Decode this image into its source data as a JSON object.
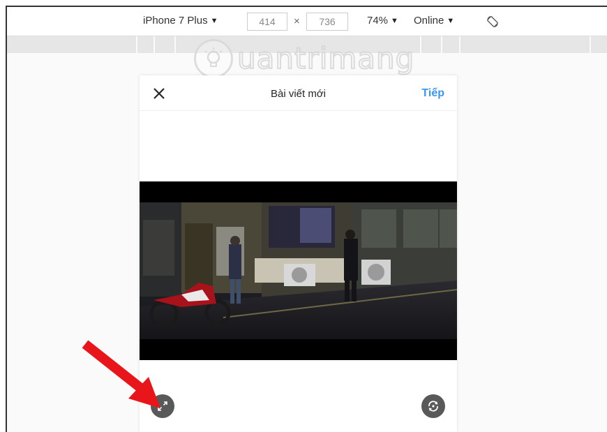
{
  "device_toolbar": {
    "device": "iPhone 7 Plus",
    "width": "414",
    "times": "×",
    "height": "736",
    "zoom": "74%",
    "network": "Online",
    "caret": "▼"
  },
  "watermark": {
    "text": "uantrimang",
    "icon": "lightbulb-icon"
  },
  "post": {
    "title": "Bài viết mới",
    "next_label": "Tiếp",
    "close_icon": "close-icon",
    "expand_icon": "expand-icon",
    "rotate_icon": "rotate-icon"
  },
  "colors": {
    "accent": "#3897f0",
    "arrow": "#e8161b",
    "control_bg": "#595959"
  }
}
